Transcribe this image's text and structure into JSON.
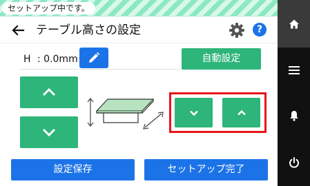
{
  "status_banner": {
    "text": "セットアップ中です。"
  },
  "header": {
    "title": "テーブル高さの設定",
    "help_label": "?"
  },
  "height": {
    "label": "H",
    "value": ": 0.0mm"
  },
  "buttons": {
    "auto_setting": "自動設定",
    "save": "設定保存",
    "finish": "セットアップ完了"
  },
  "colors": {
    "accent_green": "#2db57a",
    "accent_blue": "#1c73e8",
    "highlight_red": "#e8141c",
    "nav_bg": "#111111"
  },
  "icons": {
    "back": "arrow-left-icon",
    "settings": "gear-icon",
    "help": "help-icon",
    "edit": "pencil-icon",
    "home": "home-icon",
    "menu": "menu-icon",
    "notifications": "bell-icon",
    "power": "power-icon"
  }
}
